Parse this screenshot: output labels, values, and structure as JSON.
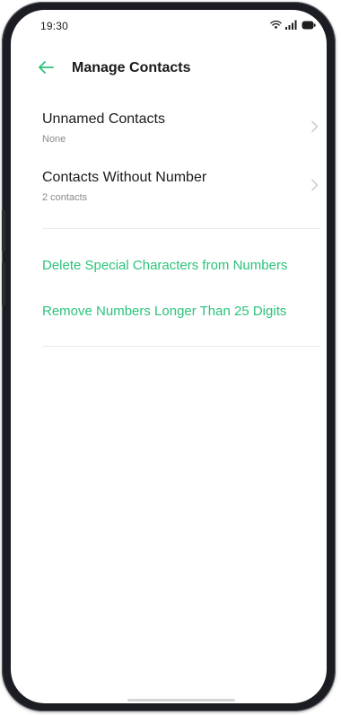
{
  "status_bar": {
    "time": "19:30",
    "wifi_icon": "wifi-icon",
    "signal_icon": "cellular-signal-icon",
    "battery_icon": "battery-icon"
  },
  "header": {
    "back_icon": "arrow-left-icon",
    "title": "Manage Contacts"
  },
  "items": [
    {
      "title": "Unnamed Contacts",
      "subtitle": "None"
    },
    {
      "title": "Contacts Without Number",
      "subtitle": "2 contacts"
    }
  ],
  "actions": [
    {
      "label": "Delete Special Characters from Numbers"
    },
    {
      "label": "Remove Numbers Longer Than 25 Digits"
    }
  ],
  "colors": {
    "accent": "#2bc37a",
    "title_text": "#1a1a1a",
    "subtitle_text": "#8a8a8a",
    "divider": "#e8e8e8",
    "chevron": "#c9c9c9"
  }
}
